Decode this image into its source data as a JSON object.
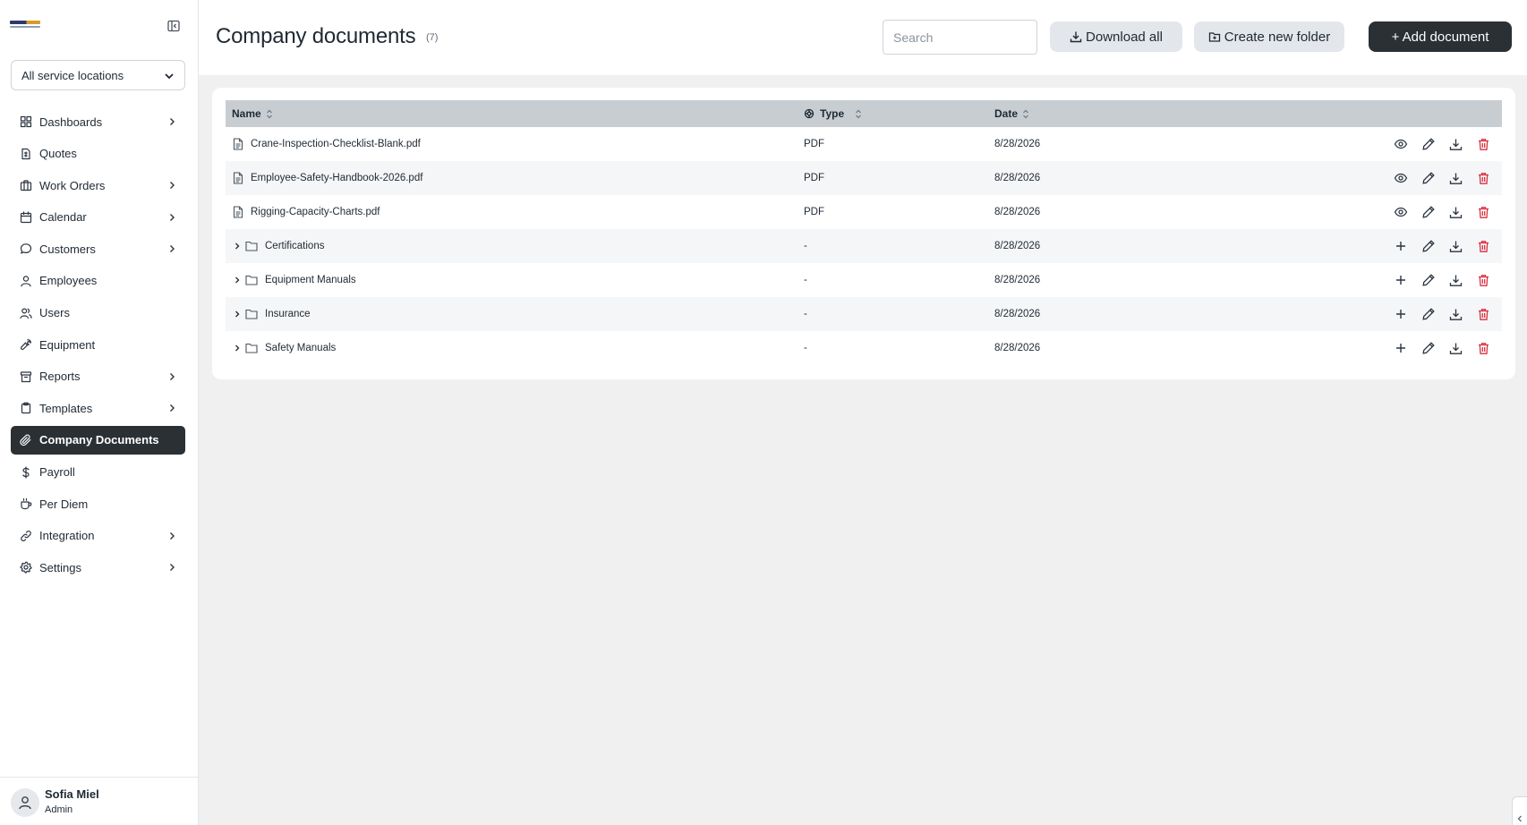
{
  "sidebar": {
    "location_select": "All service locations",
    "items": [
      {
        "label": "Dashboards",
        "icon": "dashboard-icon",
        "has_children": true
      },
      {
        "label": "Quotes",
        "icon": "quote-icon",
        "has_children": false
      },
      {
        "label": "Work Orders",
        "icon": "briefcase-icon",
        "has_children": true
      },
      {
        "label": "Calendar",
        "icon": "calendar-icon",
        "has_children": true
      },
      {
        "label": "Customers",
        "icon": "chat-icon",
        "has_children": true
      },
      {
        "label": "Employees",
        "icon": "person-icon",
        "has_children": false
      },
      {
        "label": "Users",
        "icon": "users-icon",
        "has_children": false
      },
      {
        "label": "Equipment",
        "icon": "wrench-icon",
        "has_children": false
      },
      {
        "label": "Reports",
        "icon": "archive-icon",
        "has_children": true
      },
      {
        "label": "Templates",
        "icon": "clipboard-icon",
        "has_children": true
      },
      {
        "label": "Company Documents",
        "icon": "paperclip-icon",
        "has_children": false,
        "active": true
      },
      {
        "label": "Payroll",
        "icon": "dollar-icon",
        "has_children": false
      },
      {
        "label": "Per Diem",
        "icon": "cup-icon",
        "has_children": false
      },
      {
        "label": "Integration",
        "icon": "link-icon",
        "has_children": true
      },
      {
        "label": "Settings",
        "icon": "gear-icon",
        "has_children": true
      }
    ],
    "user": {
      "name": "Sofia Miel",
      "role": "Admin"
    }
  },
  "header": {
    "title": "Company documents",
    "count": "(7)",
    "search_placeholder": "Search",
    "download_all_label": "Download all",
    "create_folder_label": "Create new folder",
    "add_document_label": "+ Add document"
  },
  "table": {
    "columns": {
      "name": "Name",
      "type": "Type",
      "date": "Date"
    },
    "rows": [
      {
        "kind": "file",
        "name": "Crane-Inspection-Checklist-Blank.pdf",
        "type": "PDF",
        "date": "8/28/2026"
      },
      {
        "kind": "file",
        "name": "Employee-Safety-Handbook-2026.pdf",
        "type": "PDF",
        "date": "8/28/2026"
      },
      {
        "kind": "file",
        "name": "Rigging-Capacity-Charts.pdf",
        "type": "PDF",
        "date": "8/28/2026"
      },
      {
        "kind": "folder",
        "name": "Certifications",
        "type": "-",
        "date": "8/28/2026"
      },
      {
        "kind": "folder",
        "name": "Equipment Manuals",
        "type": "-",
        "date": "8/28/2026"
      },
      {
        "kind": "folder",
        "name": "Insurance",
        "type": "-",
        "date": "8/28/2026"
      },
      {
        "kind": "folder",
        "name": "Safety Manuals",
        "type": "-",
        "date": "8/28/2026"
      }
    ]
  },
  "colors": {
    "accent_dark": "#2b3034",
    "delete_red": "#d9313f",
    "table_header": "#c8cdd2"
  }
}
